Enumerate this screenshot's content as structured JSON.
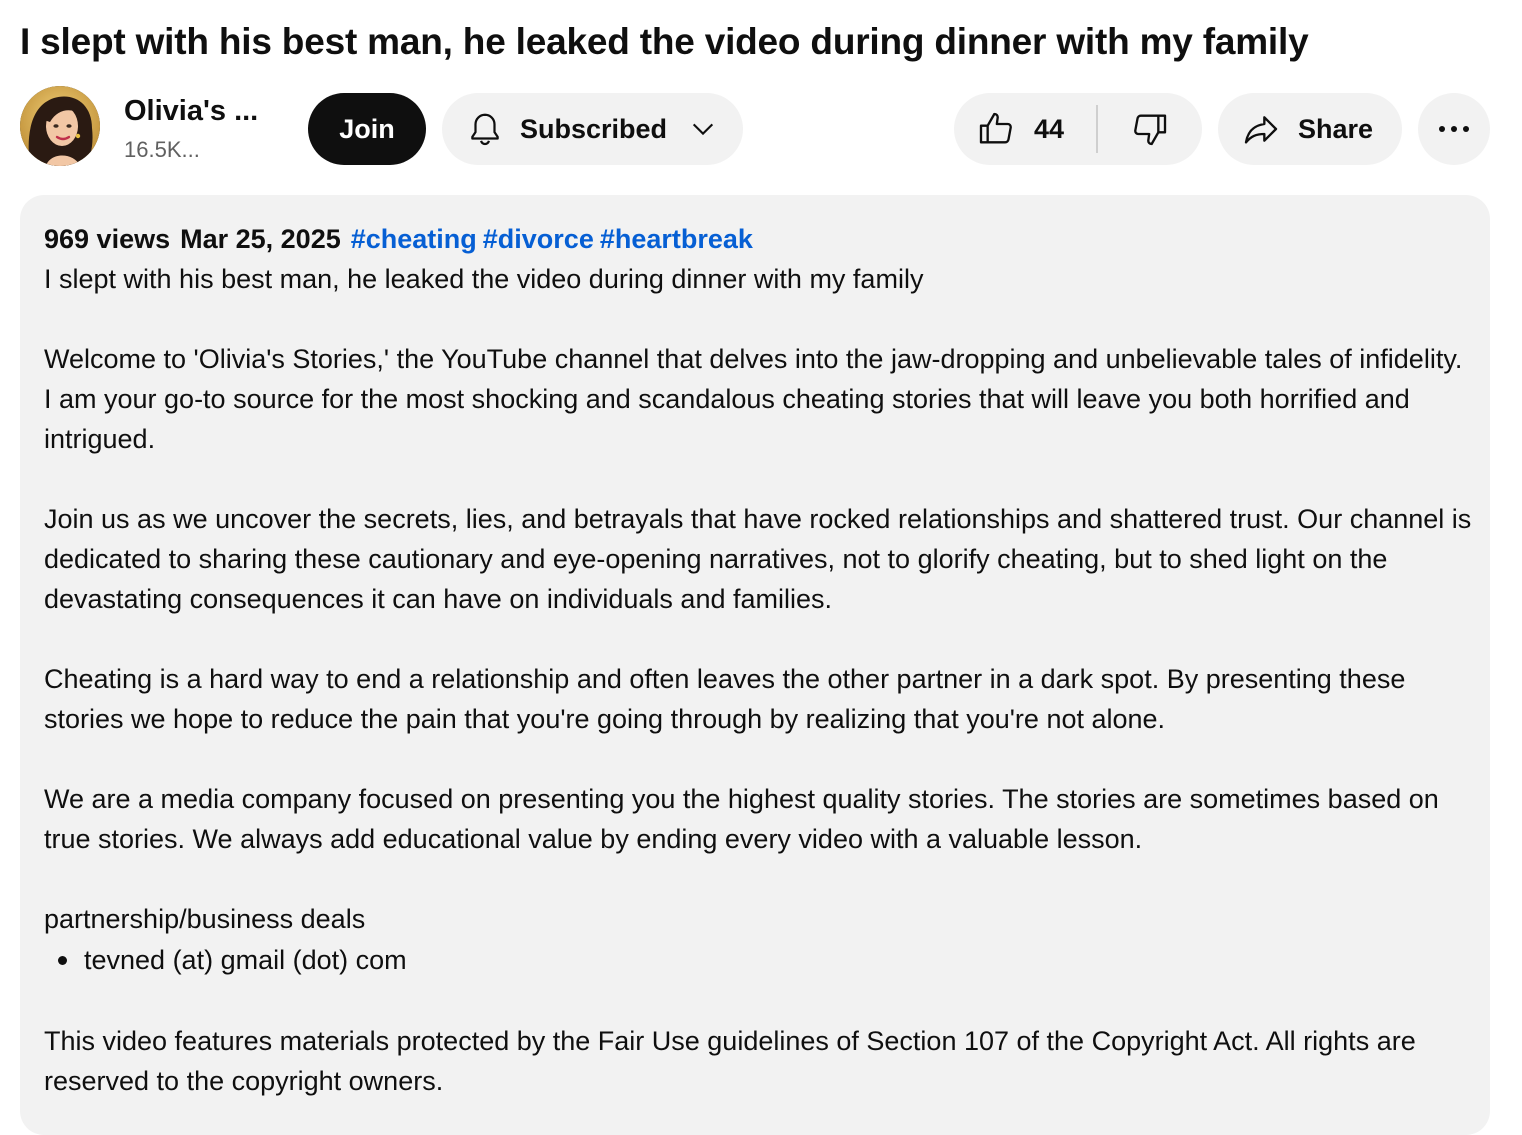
{
  "video": {
    "title": "I slept with his best man, he leaked the video during dinner with my family"
  },
  "channel": {
    "name": "Olivia's ...",
    "subscribers": "16.5K...",
    "avatar_icon": "woman-portrait-avatar"
  },
  "actions": {
    "join_label": "Join",
    "subscribed_label": "Subscribed",
    "like_count": "44",
    "share_label": "Share",
    "more_icon": "more-horizontal-icon"
  },
  "description": {
    "views": "969 views",
    "date": "Mar 25, 2025",
    "tags": [
      "#cheating",
      "#divorce",
      "#heartbreak"
    ],
    "paragraphs": [
      "I slept with his best man, he leaked the video during dinner with my family",
      "Welcome to 'Olivia's Stories,' the YouTube channel that delves into the jaw-dropping and unbelievable tales of infidelity. I am your go-to source for the most shocking and scandalous cheating stories that will leave you both horrified and intrigued.",
      "Join us as we uncover the secrets, lies, and betrayals that have rocked relationships and shattered trust. Our channel is dedicated to sharing these cautionary and eye-opening narratives, not to glorify cheating, but to shed light on the devastating consequences it can have on individuals and families.",
      "Cheating is a hard way to end a relationship and often leaves the other partner in a dark spot. By presenting these stories we hope to reduce the pain that you're going through by realizing that you're not alone.",
      "We are a media company focused on presenting you the highest quality stories. The stories are sometimes based on true stories. We always add educational value by ending every video with a valuable lesson.",
      "partnership/business deals"
    ],
    "bullets": [
      "tevned (at) gmail (dot) com"
    ],
    "footer": "This video features materials protected by the Fair Use guidelines of Section 107 of the Copyright Act. All rights are reserved to the copyright owners."
  },
  "colors": {
    "hashtag": "#065fd4",
    "pill_background": "#f2f2f2",
    "join_background": "#0f0f0f"
  }
}
